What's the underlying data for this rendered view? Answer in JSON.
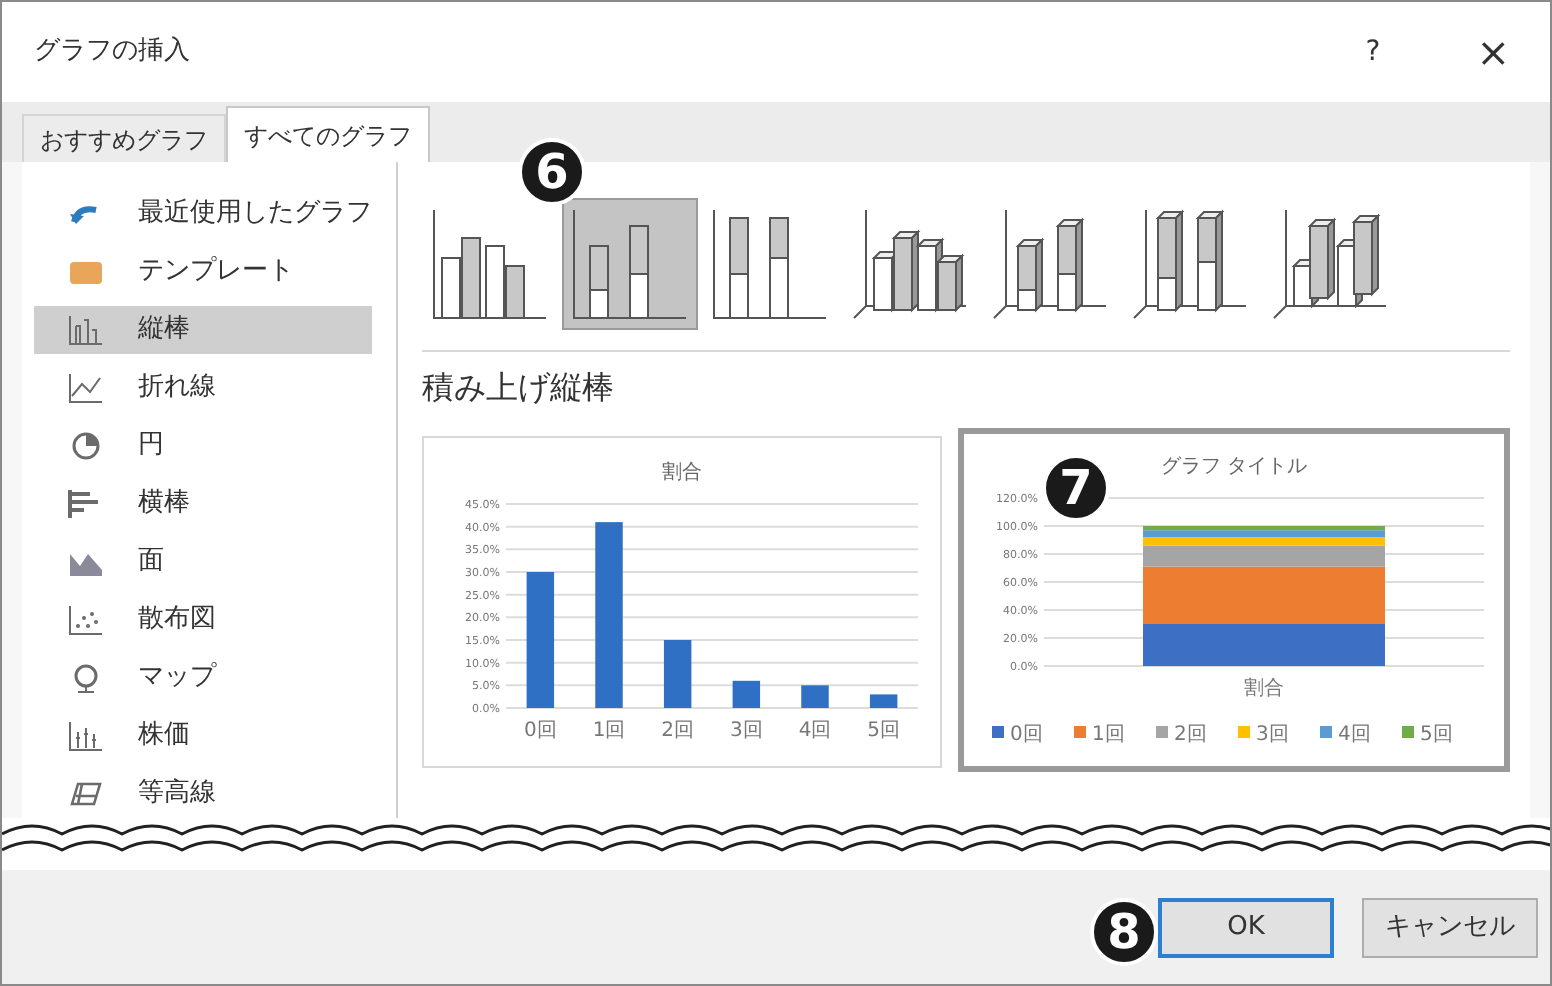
{
  "window": {
    "title": "グラフの挿入",
    "help": "?",
    "close": "×"
  },
  "tabs": [
    {
      "label": "おすすめグラフ",
      "selected": false
    },
    {
      "label": "すべてのグラフ",
      "selected": true
    }
  ],
  "chart_types": [
    {
      "kind": "recent",
      "label": "最近使用したグラフ",
      "selected": false
    },
    {
      "kind": "template",
      "label": "テンプレート",
      "selected": false
    },
    {
      "kind": "column",
      "label": "縦棒",
      "selected": true
    },
    {
      "kind": "line",
      "label": "折れ線",
      "selected": false
    },
    {
      "kind": "pie",
      "label": "円",
      "selected": false
    },
    {
      "kind": "bar",
      "label": "横棒",
      "selected": false
    },
    {
      "kind": "area",
      "label": "面",
      "selected": false
    },
    {
      "kind": "scatter",
      "label": "散布図",
      "selected": false
    },
    {
      "kind": "map",
      "label": "マップ",
      "selected": false
    },
    {
      "kind": "stock",
      "label": "株価",
      "selected": false
    },
    {
      "kind": "contour",
      "label": "等高線",
      "selected": false
    }
  ],
  "subtypes": [
    {
      "kind": "clustered",
      "selected": false
    },
    {
      "kind": "stacked",
      "selected": true
    },
    {
      "kind": "percent",
      "selected": false
    },
    {
      "kind": "isoclustered",
      "selected": false
    },
    {
      "kind": "isostacked",
      "selected": false
    },
    {
      "kind": "isopercent",
      "selected": false
    },
    {
      "kind": "isocolumn",
      "selected": false
    }
  ],
  "subtype_heading": "積み上げ縦棒",
  "previews": [
    {
      "selected": false,
      "chart_data": {
        "type": "bar",
        "title": "割合",
        "categories": [
          "0回",
          "1回",
          "2回",
          "3回",
          "4回",
          "5回"
        ],
        "grid": true,
        "series": [
          {
            "color": "#2f6fc4",
            "values": [
              30,
              41,
              15,
              6,
              5,
              3
            ]
          }
        ],
        "ylim": [
          0,
          45
        ],
        "yticks": [
          {
            "value": 0,
            "label": "0.0%"
          },
          {
            "value": 5,
            "label": "5.0%"
          },
          {
            "value": 10,
            "label": "10.0%"
          },
          {
            "value": 15,
            "label": "15.0%"
          },
          {
            "value": 20,
            "label": "20.0%"
          },
          {
            "value": 25,
            "label": "25.0%"
          },
          {
            "value": 30,
            "label": "30.0%"
          },
          {
            "value": 35,
            "label": "35.0%"
          },
          {
            "value": 40,
            "label": "40.0%"
          },
          {
            "value": 45,
            "label": "45.0%"
          }
        ]
      }
    },
    {
      "selected": true,
      "chart_data": {
        "type": "bar",
        "stacked": true,
        "grid": true,
        "legend": "bottom",
        "title": "グラフ タイトル",
        "categories": [
          "割合"
        ],
        "series": [
          {
            "name": "0回",
            "color": "#3d6fc4",
            "values": [
              30
            ]
          },
          {
            "name": "1回",
            "color": "#ed7d31",
            "values": [
              41
            ]
          },
          {
            "name": "2回",
            "color": "#a5a5a5",
            "values": [
              15
            ]
          },
          {
            "name": "3回",
            "color": "#ffc000",
            "values": [
              6
            ]
          },
          {
            "name": "4回",
            "color": "#5b9bd5",
            "values": [
              5
            ]
          },
          {
            "name": "5回",
            "color": "#70ad47",
            "values": [
              3
            ]
          }
        ],
        "ylim": [
          0,
          120
        ],
        "yticks": [
          {
            "value": 0,
            "label": "0.0%"
          },
          {
            "value": 20,
            "label": "20.0%"
          },
          {
            "value": 40,
            "label": "40.0%"
          },
          {
            "value": 60,
            "label": "60.0%"
          },
          {
            "value": 80,
            "label": "80.0%"
          },
          {
            "value": 100,
            "label": "100.0%"
          },
          {
            "value": 120,
            "label": "120.0%"
          }
        ]
      }
    }
  ],
  "callouts": [
    "6",
    "7",
    "8"
  ],
  "buttons": [
    {
      "kind": "primary",
      "label": "OK"
    },
    {
      "kind": "normal",
      "label": "キャンセル"
    }
  ]
}
